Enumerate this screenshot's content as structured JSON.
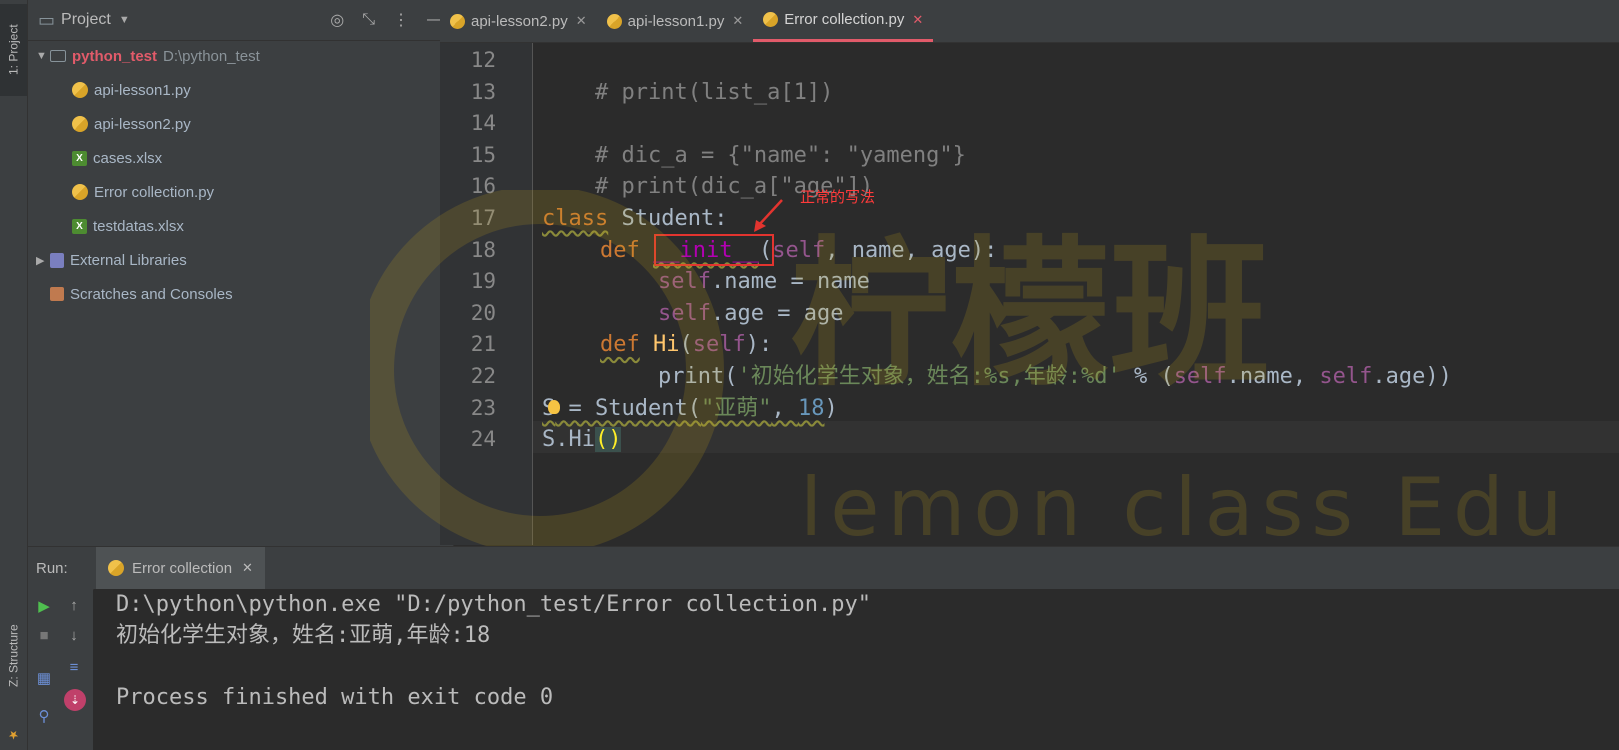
{
  "sidebar": {
    "project_tab": "1: Project",
    "structure_tab": "Z: Structure"
  },
  "project": {
    "title": "Project",
    "root_name": "python_test",
    "root_path": "D:\\python_test",
    "files": [
      "api-lesson1.py",
      "api-lesson2.py",
      "cases.xlsx",
      "Error collection.py",
      "testdatas.xlsx"
    ],
    "external_libraries": "External Libraries",
    "scratches": "Scratches and Consoles"
  },
  "editor": {
    "tabs": [
      "api-lesson2.py",
      "api-lesson1.py",
      "Error collection.py"
    ],
    "active_tab": "Error collection.py",
    "line_numbers": [
      "12",
      "13",
      "14",
      "15",
      "16",
      "17",
      "18",
      "19",
      "20",
      "21",
      "22",
      "23",
      "24"
    ],
    "code": {
      "l12": "# print(list_a[1])",
      "l14": "# dic_a = {\"name\": \"yameng\"}",
      "l15": "# print(dic_a[\"age\"])",
      "l17_kw": "class",
      "l17_name": " Student:",
      "l18_kw": "def",
      "l18_fn": "__init__",
      "l18_open": "(",
      "l18_self": "self",
      "l18_rest": ", name, age):",
      "l19_self": "self",
      "l19_rest": ".name = name",
      "l20_self": "self",
      "l20_rest": ".age = age",
      "l21_kw": "def",
      "l21_fn": "Hi",
      "l21_open": "(",
      "l21_self": "self",
      "l21_close": "):",
      "l22_print": "print(",
      "l22_str": "'初始化学生对象，姓名:%s,年龄:%d'",
      "l22_mid": " % (",
      "l22_self1": "self",
      "l22_mid2": ".name, ",
      "l22_self2": "self",
      "l22_end": ".age))",
      "l23_var": "S",
      "l23_mid": " = Student(",
      "l23_str": "\"亚萌\"",
      "l23_comma": ", ",
      "l23_num": "18",
      "l23_end": ")",
      "l24_a": "S.Hi",
      "l24_paren": "()"
    },
    "annotation": "正常的写法"
  },
  "run": {
    "label": "Run:",
    "tab": "Error collection",
    "output": [
      "D:\\python\\python.exe \"D:/python_test/Error collection.py\"",
      "初始化学生对象，姓名:亚萌,年龄:18",
      "",
      "Process finished with exit code 0"
    ]
  },
  "watermark": {
    "cn": "柠檬班",
    "en": "lemon class Edu"
  },
  "colors": {
    "accent": "#e25b6a",
    "annotation_red": "#e3342f",
    "keyword": "#cc7832",
    "self": "#94558d",
    "string": "#6a8759",
    "number": "#6897bb"
  }
}
